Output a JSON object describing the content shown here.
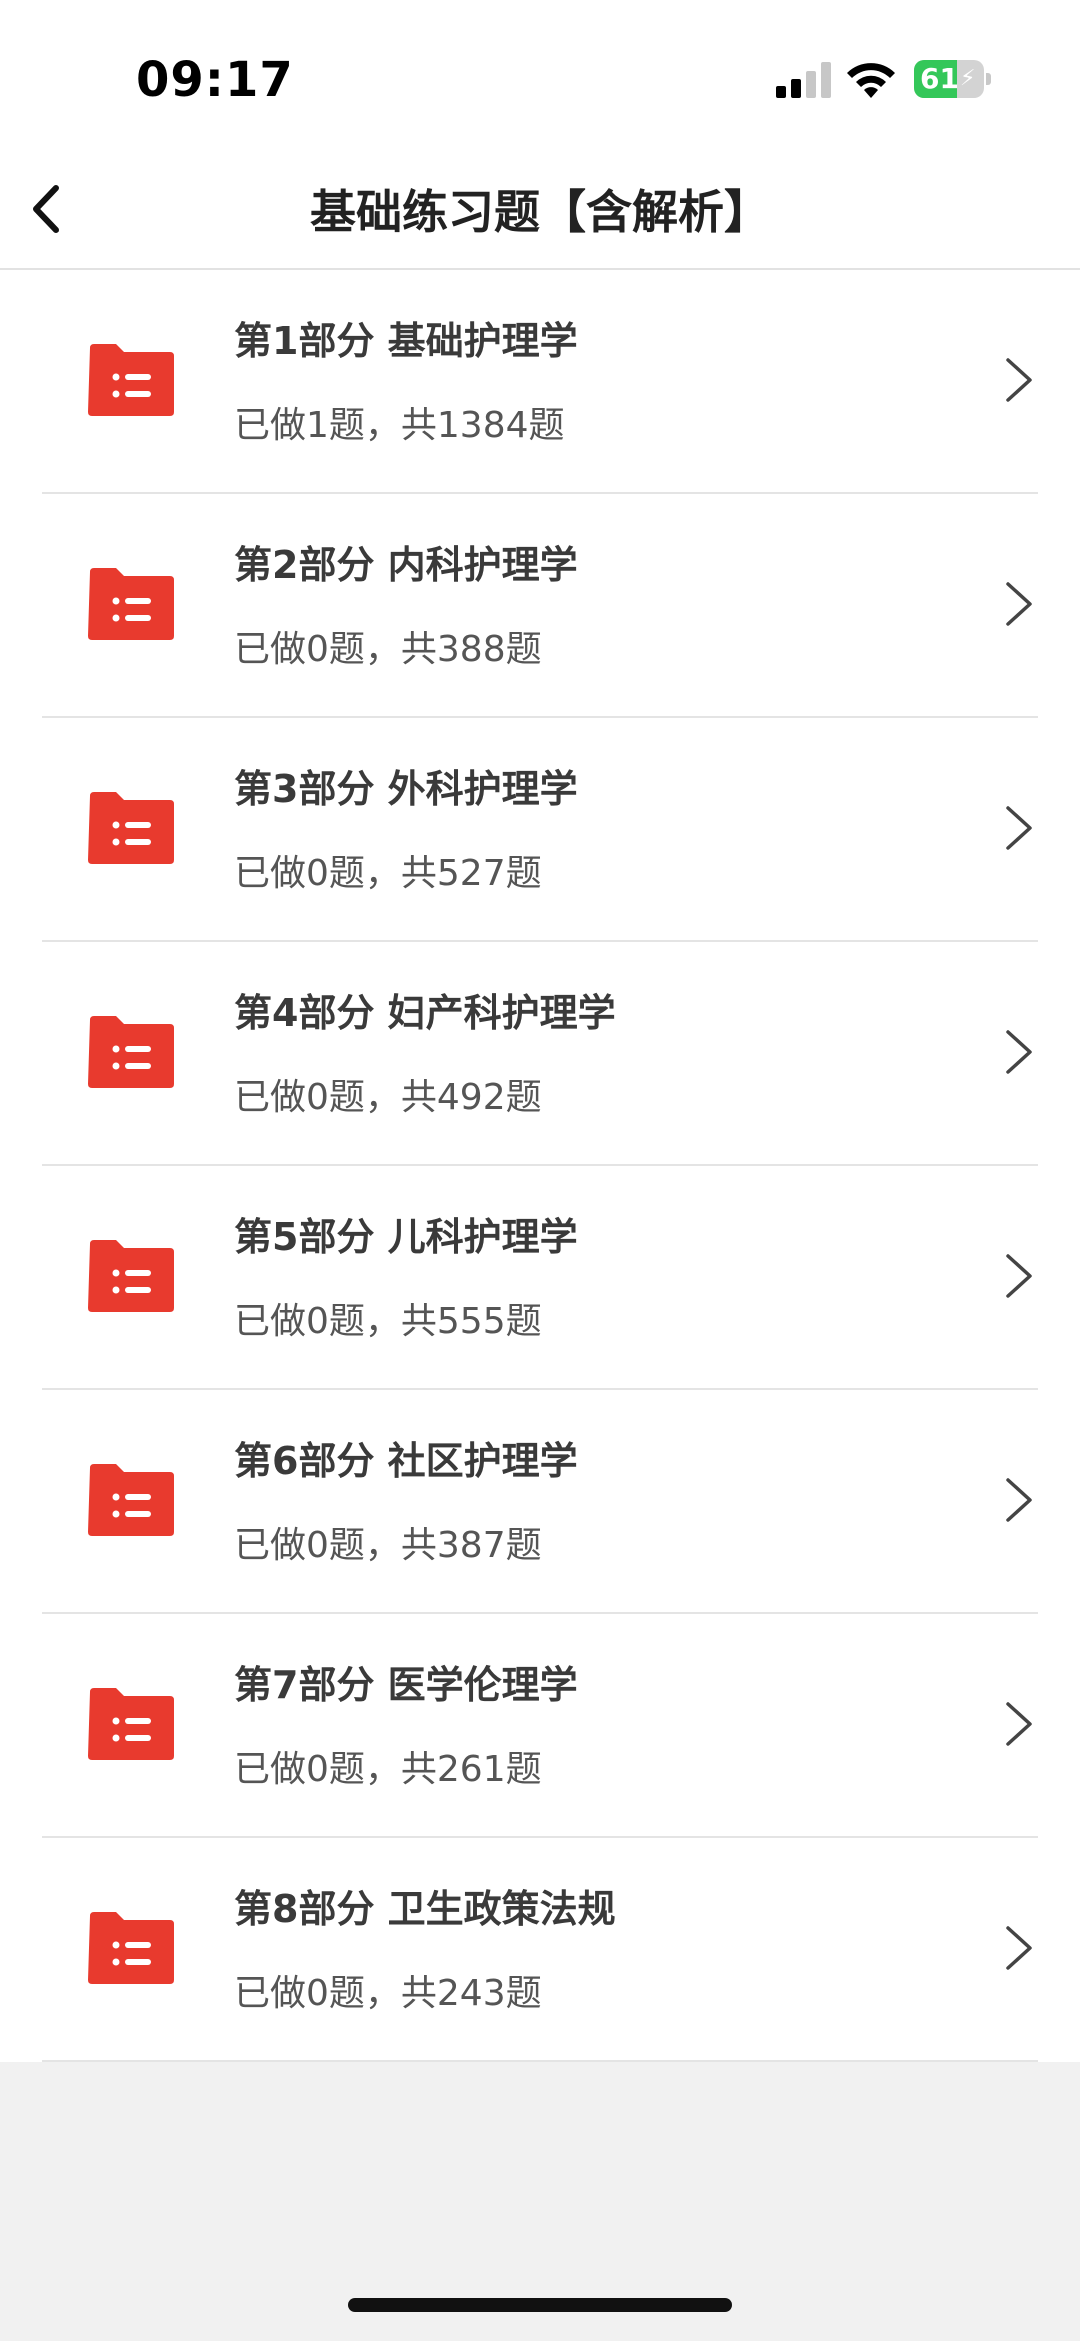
{
  "status_bar": {
    "time": "09:17",
    "battery_level": "61",
    "battery_percent": 61,
    "battery_color": "#34c759"
  },
  "nav": {
    "back_icon": "chevron-left-icon",
    "title": "基础练习题【含解析】"
  },
  "theme": {
    "folder_color": "#e83a2e"
  },
  "items": [
    {
      "title": "第1部分 基础护理学",
      "progress": "已做1题，共1384题"
    },
    {
      "title": "第2部分 内科护理学",
      "progress": "已做0题，共388题"
    },
    {
      "title": "第3部分 外科护理学",
      "progress": "已做0题，共527题"
    },
    {
      "title": "第4部分 妇产科护理学",
      "progress": "已做0题，共492题"
    },
    {
      "title": "第5部分 儿科护理学",
      "progress": "已做0题，共555题"
    },
    {
      "title": "第6部分 社区护理学",
      "progress": "已做0题，共387题"
    },
    {
      "title": "第7部分 医学伦理学",
      "progress": "已做0题，共261题"
    },
    {
      "title": "第8部分 卫生政策法规",
      "progress": "已做0题，共243题"
    }
  ]
}
